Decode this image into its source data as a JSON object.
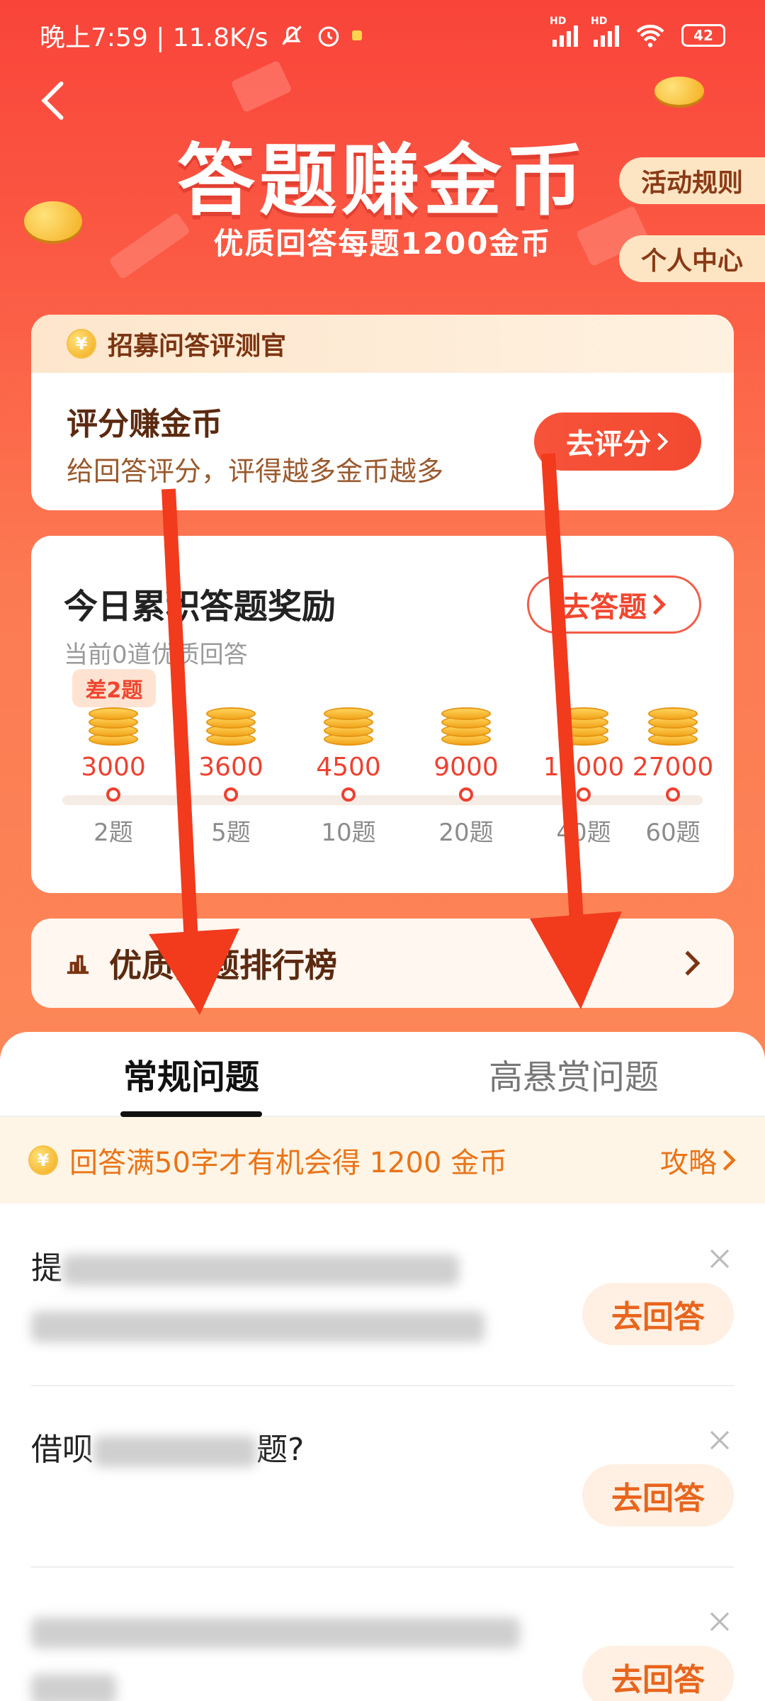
{
  "status_bar": {
    "time_speed": "晚上7:59 | 11.8K/s",
    "battery": "42",
    "hd1": "HD",
    "hd2": "HD"
  },
  "header": {
    "title": "答题赚金币",
    "subtitle": "优质回答每题1200金币",
    "rules_button": "活动规则",
    "personal_center_button": "个人中心"
  },
  "recruit_card": {
    "header": "招募问答评测官",
    "coin_symbol": "¥",
    "title": "评分赚金币",
    "description": "给回答评分，评得越多金币越多",
    "button": "去评分"
  },
  "reward_card": {
    "title": "今日累积答题奖励",
    "subtitle": "当前0道优质回答",
    "button": "去答题",
    "badge": "差2题",
    "steps": [
      {
        "amount": "3000",
        "count": "2题"
      },
      {
        "amount": "3600",
        "count": "5题"
      },
      {
        "amount": "4500",
        "count": "10题"
      },
      {
        "amount": "9000",
        "count": "20题"
      },
      {
        "amount": "18000",
        "count": "40题"
      },
      {
        "amount": "27000",
        "count": "60题"
      }
    ]
  },
  "ranking": {
    "label": "优质问题排行榜"
  },
  "tabs": {
    "regular": "常规问题",
    "high_reward": "高悬赏问题"
  },
  "notice": {
    "text": "回答满50字才有机会得 1200 金币",
    "link": "攻略",
    "coin_symbol": "¥"
  },
  "questions": [
    {
      "visible_start": "提",
      "answer_button": "去回答"
    },
    {
      "visible_start": "借呗",
      "visible_end": "题?",
      "answer_button": "去回答"
    },
    {
      "visible_start": "",
      "answer_button": "去回答"
    }
  ],
  "colors": {
    "accent_red": "#f24a31",
    "hero_top": "#f9443a",
    "notice_orange": "#ea7418",
    "arrow_red": "#f23a1d"
  }
}
